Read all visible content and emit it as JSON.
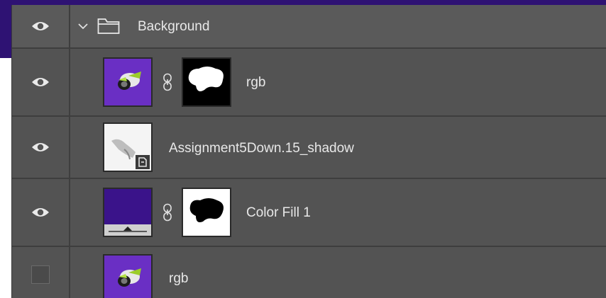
{
  "layers_panel": {
    "group": {
      "name": "Background",
      "expanded": true,
      "visible": true,
      "icons": {
        "visibility": "eye-icon",
        "disclosure": "chevron-down-icon",
        "type": "folder-icon"
      }
    },
    "layers": [
      {
        "name": "rgb",
        "visible": true,
        "thumbnail": "image-thumbnail",
        "linked_mask": true
      },
      {
        "name": "Assignment5Down.15_shadow",
        "visible": true,
        "thumbnail": "smart-object-thumbnail",
        "linked_mask": false
      },
      {
        "name": "Color Fill 1",
        "visible": true,
        "thumbnail": "color-fill-thumbnail",
        "linked_mask": true
      },
      {
        "name": "rgb",
        "visible": false,
        "thumbnail": "image-thumbnail",
        "linked_mask": false
      }
    ]
  },
  "colors": {
    "accent_background": "#2e1273",
    "panel_background": "#535353",
    "thumbnail_purple": "#6a2fc4",
    "color_fill": "#3a138a",
    "text": "#e8e8e8"
  }
}
